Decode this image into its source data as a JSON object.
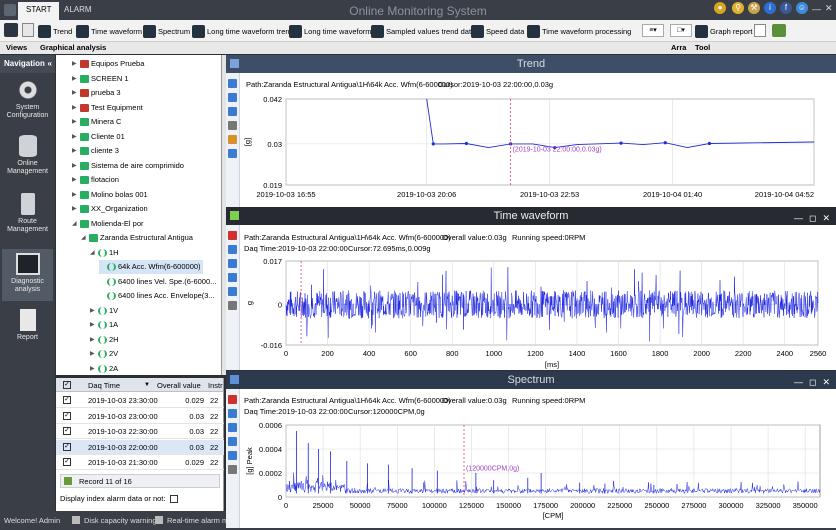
{
  "titlebar": {
    "app_title": "Online Monitoring System",
    "tabs": [
      "START",
      "ALARM"
    ],
    "window_icons": [
      "lock-icon",
      "key-icon",
      "tools-icon",
      "info-icon",
      "facebook-icon",
      "user-icon",
      "minimize-icon",
      "close-icon"
    ]
  },
  "ribbon": {
    "buttons": [
      {
        "label": "Trend",
        "icon": "trend-icon"
      },
      {
        "label": "Time waveform",
        "icon": "waveform-icon"
      },
      {
        "label": "Spectrum",
        "icon": "spectrum-icon"
      },
      {
        "label": "Long time waveform trend",
        "icon": "long-trend-icon"
      },
      {
        "label": "Long time waveform",
        "icon": "long-waveform-icon"
      },
      {
        "label": "Sampled values trend data",
        "icon": "sampled-data-icon"
      },
      {
        "label": "Speed data",
        "icon": "speed-icon"
      },
      {
        "label": "Time waveform processing",
        "icon": "processing-icon"
      },
      {
        "label": "Graph report",
        "icon": "report-icon"
      }
    ],
    "sub_labels": {
      "views": "Views",
      "graphical": "Graphical analysis",
      "arra": "Arra",
      "tool": "Tool"
    }
  },
  "nav": {
    "header": "Navigation",
    "items": [
      {
        "label": "System Configuration",
        "icon": "gear-icon"
      },
      {
        "label": "Online Management",
        "icon": "database-icon"
      },
      {
        "label": "Route Management",
        "icon": "handheld-icon"
      },
      {
        "label": "Diagnostic analysis",
        "icon": "monitor-chart-icon",
        "selected": true
      },
      {
        "label": "Report",
        "icon": "document-icon"
      }
    ]
  },
  "tree": [
    {
      "label": "Equipos Prueba",
      "level": 1,
      "color": "#c0392b",
      "expanded": false
    },
    {
      "label": "SCREEN 1",
      "level": 1,
      "color": "#27ae60",
      "expanded": false
    },
    {
      "label": "prueba 3",
      "level": 1,
      "color": "#c0392b",
      "expanded": false
    },
    {
      "label": "Test Equipment",
      "level": 1,
      "color": "#c0392b",
      "expanded": false
    },
    {
      "label": "Minera C",
      "level": 1,
      "color": "#27ae60",
      "expanded": false
    },
    {
      "label": "Cliente 01",
      "level": 1,
      "color": "#27ae60",
      "expanded": false
    },
    {
      "label": "cliente 3",
      "level": 1,
      "color": "#27ae60",
      "expanded": false
    },
    {
      "label": "Sistema de aire comprimido",
      "level": 1,
      "color": "#27ae60",
      "expanded": false
    },
    {
      "label": "flotacion",
      "level": 1,
      "color": "#27ae60",
      "expanded": false
    },
    {
      "label": "Molino bolas 001",
      "level": 1,
      "color": "#27ae60",
      "expanded": false
    },
    {
      "label": "XX_Organization",
      "level": 1,
      "color": "#27ae60",
      "expanded": false
    },
    {
      "label": "Molienda-El por",
      "level": 1,
      "color": "#27ae60",
      "expanded": true
    },
    {
      "label": "Zaranda Estructural Antigua",
      "level": 2,
      "color": "#27ae60",
      "expanded": true
    },
    {
      "label": "1H",
      "level": 3,
      "color": "#27ae60",
      "expanded": true
    },
    {
      "label": "64k Acc. Wfm(6-600000)",
      "level": 4,
      "color": "#27ae60",
      "selected": true
    },
    {
      "label": "6400 lines Vel. Spe.(6-6000...",
      "level": 4,
      "color": "#27ae60"
    },
    {
      "label": "6400 lines Acc. Envelope(3...",
      "level": 4,
      "color": "#27ae60"
    },
    {
      "label": "1V",
      "level": 3,
      "color": "#27ae60",
      "expanded": false
    },
    {
      "label": "1A",
      "level": 3,
      "color": "#27ae60",
      "expanded": false
    },
    {
      "label": "2H",
      "level": 3,
      "color": "#27ae60",
      "expanded": false
    },
    {
      "label": "2V",
      "level": 3,
      "color": "#27ae60",
      "expanded": false
    },
    {
      "label": "2A",
      "level": 3,
      "color": "#27ae60",
      "expanded": false
    }
  ],
  "grid": {
    "columns": [
      "Daq Time",
      "Overall value",
      "Instr"
    ],
    "rows": [
      {
        "time": "2019-10-03 23:30:00",
        "value": "0.029",
        "instr": "22",
        "checked": true
      },
      {
        "time": "2019-10-03 23:00:00",
        "value": "0.03",
        "instr": "22",
        "checked": true
      },
      {
        "time": "2019-10-03 22:30:00",
        "value": "0.03",
        "instr": "22",
        "checked": true
      },
      {
        "time": "2019-10-03 22:00:00",
        "value": "0.03",
        "instr": "22",
        "checked": true,
        "selected": true
      },
      {
        "time": "2019-10-03 21:30:00",
        "value": "0.029",
        "instr": "22",
        "checked": true
      }
    ],
    "record_text": "Record 11 of 16",
    "display_alarm_label": "Display index alarm data or not:"
  },
  "statusbar": {
    "welcome": "Welcome!  Admin",
    "disk": "Disk capacity warning",
    "realtime": "Real-time alarm mor"
  },
  "trend": {
    "title": "Trend",
    "path": "Path:Zaranda Estructural Antigua\\1H\\64k Acc. Wfm(6-600000)",
    "cursor": "Cursor:2019-10-03 22:00:00,0.03g",
    "ylabel": "[g]",
    "cursor_label": "(2019-10-03 22:00:00,0.03g)"
  },
  "waveform": {
    "title": "Time waveform",
    "path": "Path:Zaranda Estructural Antigua\\1H\\64k Acc. Wfm(6-600000)",
    "overall": "Overall value:0.03g",
    "speed": "Running speed:0RPM",
    "daq": "Daq Time:2019-10-03 22:00:00",
    "cursor": "Cursor:72.695ms,0.009g",
    "ylabel": "g",
    "xlabel": "[ms]"
  },
  "spectrum": {
    "title": "Spectrum",
    "path": "Path:Zaranda Estructural Antigua\\1H\\64k Acc. Wfm(6-600000)",
    "overall": "Overall value:0.03g",
    "speed": "Running speed:0RPM",
    "daq": "Daq Time:2019-10-03 22:00:00",
    "cursor": "Cursor:120000CPM,0g",
    "ylabel": "[g] Peak",
    "xlabel": "[CPM]",
    "cursor_label": "(120000CPM,0g)"
  },
  "chart_data": [
    {
      "type": "line",
      "title": "Trend",
      "ylabel": "[g]",
      "ylim": [
        0.019,
        0.042
      ],
      "yticks": [
        "0.042",
        "0.03",
        "0.019"
      ],
      "xticks": [
        "2019-10-03 16:55",
        "2019-10-03 20:06",
        "2019-10-03 22:53",
        "2019-10-04 01:40",
        "2019-10-04 04:52"
      ],
      "x": [
        "2019-10-03 20:06",
        "2019-10-03 20:15",
        "2019-10-03 20:30",
        "2019-10-03 21:00",
        "2019-10-03 21:30",
        "2019-10-03 22:00",
        "2019-10-03 22:30",
        "2019-10-03 23:00",
        "2019-10-03 23:30",
        "2019-10-04 00:30",
        "2019-10-04 01:00",
        "2019-10-04 01:30",
        "2019-10-04 02:00",
        "2019-10-04 02:30",
        "2019-10-04 04:52"
      ],
      "values": [
        0.042,
        0.03,
        0.03,
        0.0301,
        0.029,
        0.03,
        0.03,
        0.029,
        0.0298,
        0.0302,
        0.0298,
        0.0303,
        0.029,
        0.0301,
        0.0305
      ],
      "grid": true
    },
    {
      "type": "line",
      "title": "Time waveform",
      "xlabel": "[ms]",
      "ylabel": "g",
      "xlim": [
        0,
        2560
      ],
      "ylim": [
        -0.016,
        0.017
      ],
      "yticks": [
        "0.017",
        "0",
        "-0.016"
      ],
      "xticks": [
        "0",
        "200",
        "400",
        "600",
        "800",
        "1000",
        "1200",
        "1400",
        "1600",
        "1800",
        "2000",
        "2200",
        "2400",
        "2560"
      ],
      "series": [
        {
          "values": "dense noise within ±0.009g with spikes to ±0.016g"
        }
      ],
      "cursor_x": 72.695,
      "grid": true
    },
    {
      "type": "line",
      "title": "Spectrum",
      "xlabel": "[CPM]",
      "ylabel": "[g] Peak",
      "xlim": [
        0,
        360000
      ],
      "ylim": [
        0,
        0.0006
      ],
      "yticks": [
        "0.0006",
        "0.0004",
        "0.0002",
        "0"
      ],
      "xticks": [
        "0",
        "25000",
        "50000",
        "75000",
        "100000",
        "125000",
        "150000",
        "175000",
        "200000",
        "225000",
        "250000",
        "275000",
        "300000",
        "325000",
        "350000"
      ],
      "peaks": [
        [
          7000,
          0.00055
        ],
        [
          15000,
          0.00045
        ],
        [
          22000,
          0.0004
        ],
        [
          30000,
          0.00038
        ],
        [
          41000,
          0.0003
        ],
        [
          55000,
          0.00028
        ],
        [
          69000,
          0.00027
        ],
        [
          85000,
          0.00024
        ],
        [
          102000,
          0.00022
        ],
        [
          128000,
          0.0002
        ],
        [
          140000,
          0.00014
        ],
        [
          163000,
          0.00016
        ],
        [
          172000,
          0.0002
        ],
        [
          198000,
          0.00012
        ],
        [
          215000,
          0.00011
        ],
        [
          248000,
          0.0001
        ]
      ],
      "cursor_x": 120000,
      "grid": true
    }
  ]
}
